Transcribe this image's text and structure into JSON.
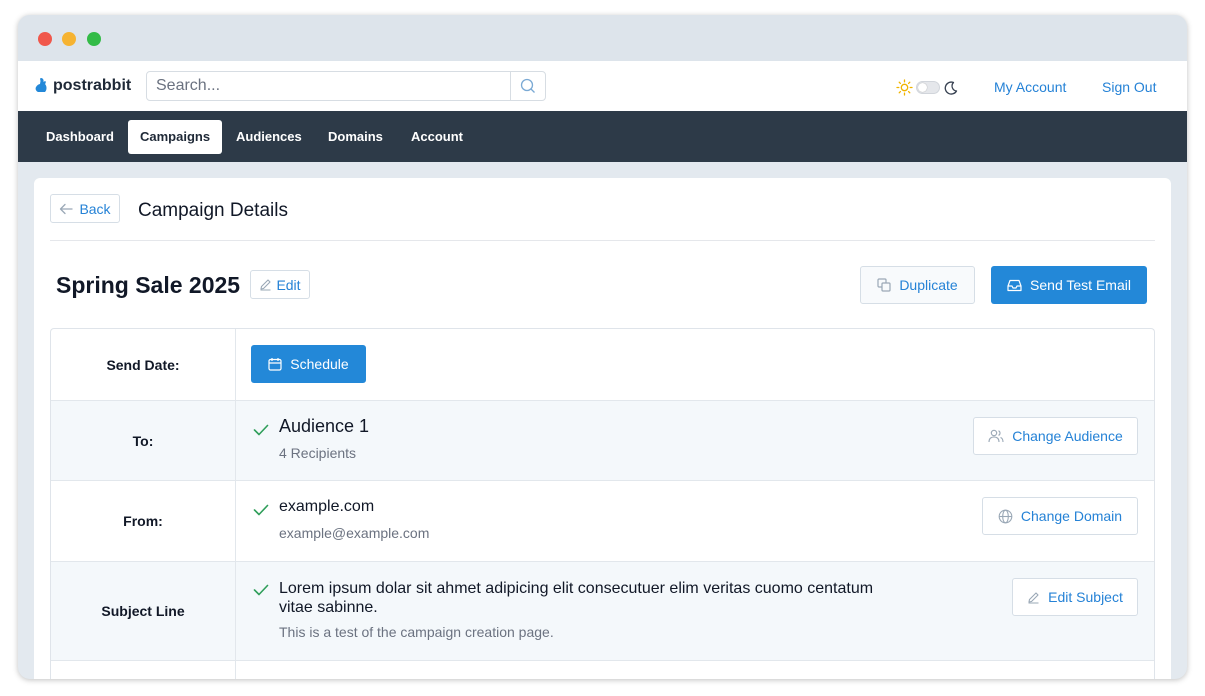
{
  "app": {
    "logo_text": "postrabbit"
  },
  "search": {
    "placeholder": "Search..."
  },
  "header_links": {
    "my_account": "My Account",
    "sign_out": "Sign Out"
  },
  "theme": {
    "mode": "light"
  },
  "nav": {
    "items": [
      {
        "label": "Dashboard",
        "active": false
      },
      {
        "label": "Campaigns",
        "active": true
      },
      {
        "label": "Audiences",
        "active": false
      },
      {
        "label": "Domains",
        "active": false
      },
      {
        "label": "Account",
        "active": false
      }
    ]
  },
  "page": {
    "back_label": "Back",
    "title": "Campaign Details",
    "campaign_name": "Spring Sale 2025",
    "edit_label": "Edit",
    "duplicate_label": "Duplicate",
    "send_test_label": "Send Test Email"
  },
  "details": {
    "send_date": {
      "label": "Send Date:",
      "button": "Schedule"
    },
    "to": {
      "label": "To:",
      "value": "Audience 1",
      "sub": "4 Recipients",
      "button": "Change Audience"
    },
    "from": {
      "label": "From:",
      "value": "example.com",
      "sub": "example@example.com",
      "button": "Change Domain"
    },
    "subject": {
      "label": "Subject Line",
      "value": "Lorem ipsum dolar sit ahmet adipicing elit consecutuer elim veritas cuomo centatum vitae sabinne.",
      "sub": "This is a test of the campaign creation page.",
      "button": "Edit Subject"
    }
  },
  "colors": {
    "accent": "#2388d8",
    "nav_bg": "#2d3a48",
    "check": "#2f9e5a"
  }
}
